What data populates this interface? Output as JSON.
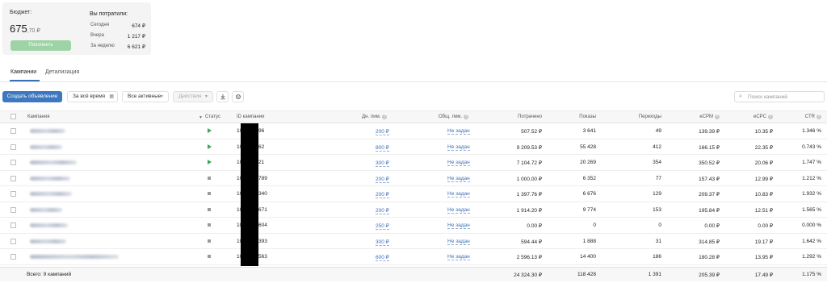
{
  "budget": {
    "label": "Бюджет:",
    "value_int": "675",
    "value_frac": ",70 ₽",
    "topup_label": "Пополнить"
  },
  "spent": {
    "title": "Вы потратили:",
    "rows": [
      {
        "label": "Сегодня",
        "value": "674 ₽"
      },
      {
        "label": "Вчера",
        "value": "1 217 ₽"
      },
      {
        "label": "За неделю",
        "value": "6 621 ₽"
      }
    ]
  },
  "tabs": [
    {
      "label": "Кампании",
      "active": true
    },
    {
      "label": "Детализация",
      "active": false
    }
  ],
  "toolbar": {
    "create_label": "Создать объявление",
    "period_label": "За всё время",
    "filter_label": "Все активные",
    "actions_label": "Действия",
    "download_icon": "download-icon",
    "settings_icon": "gear-icon"
  },
  "search": {
    "placeholder": "Поиск кампаний",
    "value": ""
  },
  "table": {
    "headers": {
      "campaign": "Кампания",
      "status": "Статус",
      "id": "ID кампании",
      "daily_limit": "Дн. лим.",
      "total_limit": "Общ. лим.",
      "spent": "Потрачено",
      "impressions": "Показы",
      "clicks": "Переходы",
      "ecpm": "eCPM",
      "ecpc": "eCPC",
      "ctr": "CTR"
    },
    "rows": [
      {
        "status": "active",
        "id_start": "10",
        "id_end": "96",
        "daily": "200 ₽",
        "total": "Не задан",
        "spent": "507.52 ₽",
        "impressions": "3 641",
        "clicks": "49",
        "ecpm": "139.39 ₽",
        "ecpc": "10.35 ₽",
        "ctr": "1.346 %"
      },
      {
        "status": "active",
        "id_start": "10",
        "id_end": "62",
        "daily": "800 ₽",
        "total": "Не задан",
        "spent": "9 209.53 ₽",
        "impressions": "55 428",
        "clicks": "412",
        "ecpm": "166.15 ₽",
        "ecpc": "22.35 ₽",
        "ctr": "0.743 %"
      },
      {
        "status": "active",
        "id_start": "10",
        "id_end": "21",
        "daily": "300 ₽",
        "total": "Не задан",
        "spent": "7 104.72 ₽",
        "impressions": "20 269",
        "clicks": "354",
        "ecpm": "350.52 ₽",
        "ecpc": "20.06 ₽",
        "ctr": "1.747 %"
      },
      {
        "status": "paused",
        "id_start": "10",
        "id_end": "789",
        "daily": "200 ₽",
        "total": "Не задан",
        "spent": "1 000.00 ₽",
        "impressions": "6 352",
        "clicks": "77",
        "ecpm": "157.43 ₽",
        "ecpc": "12.99 ₽",
        "ctr": "1.212 %"
      },
      {
        "status": "paused",
        "id_start": "10",
        "id_end": "340",
        "daily": "200 ₽",
        "total": "Не задан",
        "spent": "1 397.76 ₽",
        "impressions": "6 676",
        "clicks": "129",
        "ecpm": "209.37 ₽",
        "ecpc": "10.83 ₽",
        "ctr": "1.932 %"
      },
      {
        "status": "paused",
        "id_start": "10",
        "id_end": "671",
        "daily": "200 ₽",
        "total": "Не задан",
        "spent": "1 914.20 ₽",
        "impressions": "9 774",
        "clicks": "153",
        "ecpm": "195.84 ₽",
        "ecpc": "12.51 ₽",
        "ctr": "1.565 %"
      },
      {
        "status": "paused",
        "id_start": "10",
        "id_end": "604",
        "daily": "250 ₽",
        "total": "Не задан",
        "spent": "0.00 ₽",
        "impressions": "0",
        "clicks": "0",
        "ecpm": "0.00 ₽",
        "ecpc": "0.00 ₽",
        "ctr": "0.000 %"
      },
      {
        "status": "paused",
        "id_start": "10",
        "id_end": "393",
        "daily": "300 ₽",
        "total": "Не задан",
        "spent": "594.44 ₽",
        "impressions": "1 888",
        "clicks": "31",
        "ecpm": "314.85 ₽",
        "ecpc": "19.17 ₽",
        "ctr": "1.642 %"
      },
      {
        "status": "paused",
        "id_start": "10",
        "id_end": "563",
        "daily": "600 ₽",
        "total": "Не задан",
        "spent": "2 596.13 ₽",
        "impressions": "14 400",
        "clicks": "186",
        "ecpm": "180.28 ₽",
        "ecpc": "13.95 ₽",
        "ctr": "1.292 %"
      }
    ],
    "footer": {
      "label": "Всего: 9 кампаний",
      "spent": "24 324.30 ₽",
      "impressions": "118 428",
      "clicks": "1 391",
      "ecpm": "205.39 ₽",
      "ecpc": "17.49 ₽",
      "ctr": "1.175 %"
    }
  },
  "colors": {
    "accent": "#3d78c0",
    "active_status": "#3aa655",
    "paused_status": "#9a9a9a",
    "topup_disabled": "#9fd3a5"
  }
}
